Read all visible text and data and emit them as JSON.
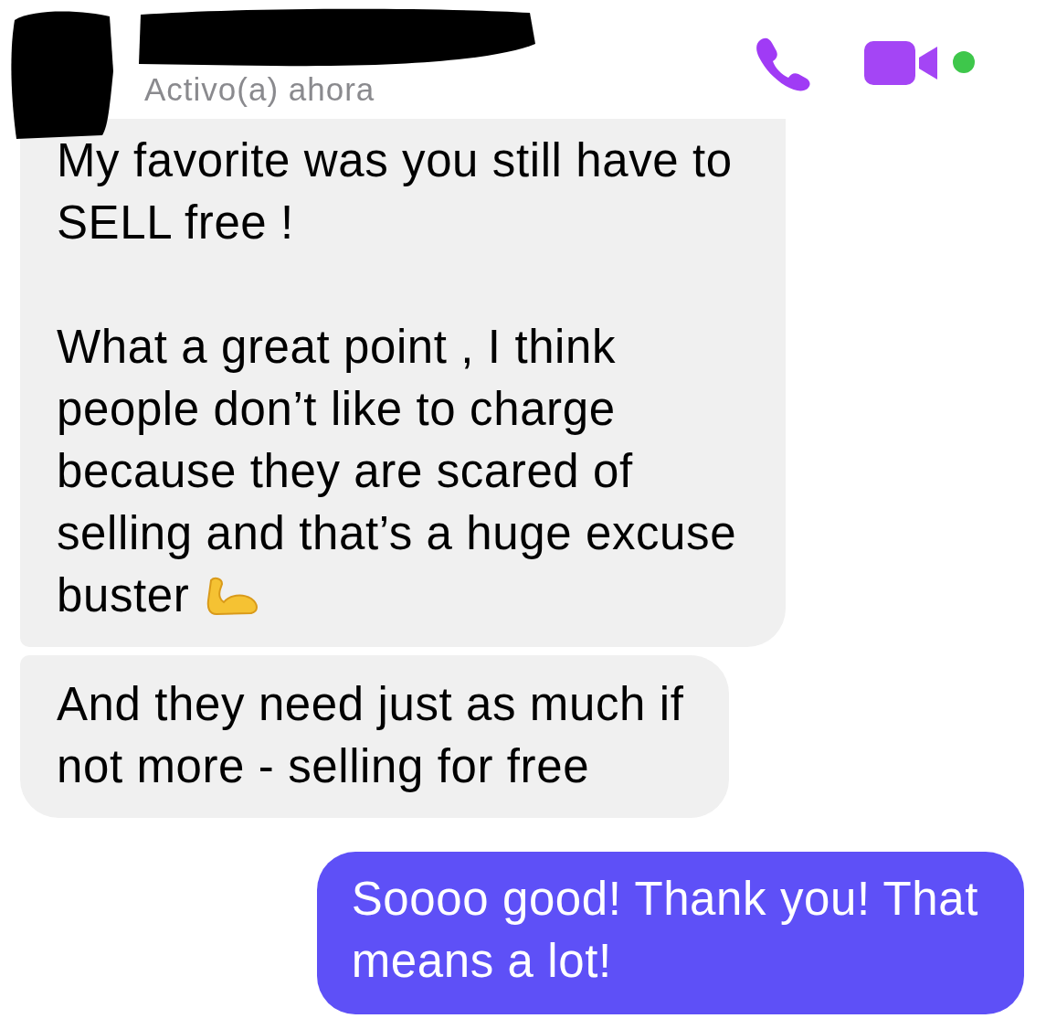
{
  "header": {
    "status": "Activo(a) ahora",
    "online": true
  },
  "messages": [
    {
      "kind": "incoming",
      "paragraphs": [
        {
          "text": "My favorite was you still have to\nSELL free !",
          "emoji": false
        },
        {
          "text": "What a great point , I think\npeople don’t like to charge\nbecause they are scared of\nselling and that’s a huge excuse\nbuster",
          "emoji": true
        }
      ]
    },
    {
      "kind": "incoming",
      "paragraphs": [
        {
          "text": "And they need just as much if\nnot more - selling for free",
          "emoji": false
        }
      ]
    },
    {
      "kind": "outgoing",
      "paragraphs": [
        {
          "text": "Soooo good! Thank you! That\nmeans a lot!",
          "emoji": false
        }
      ]
    }
  ]
}
